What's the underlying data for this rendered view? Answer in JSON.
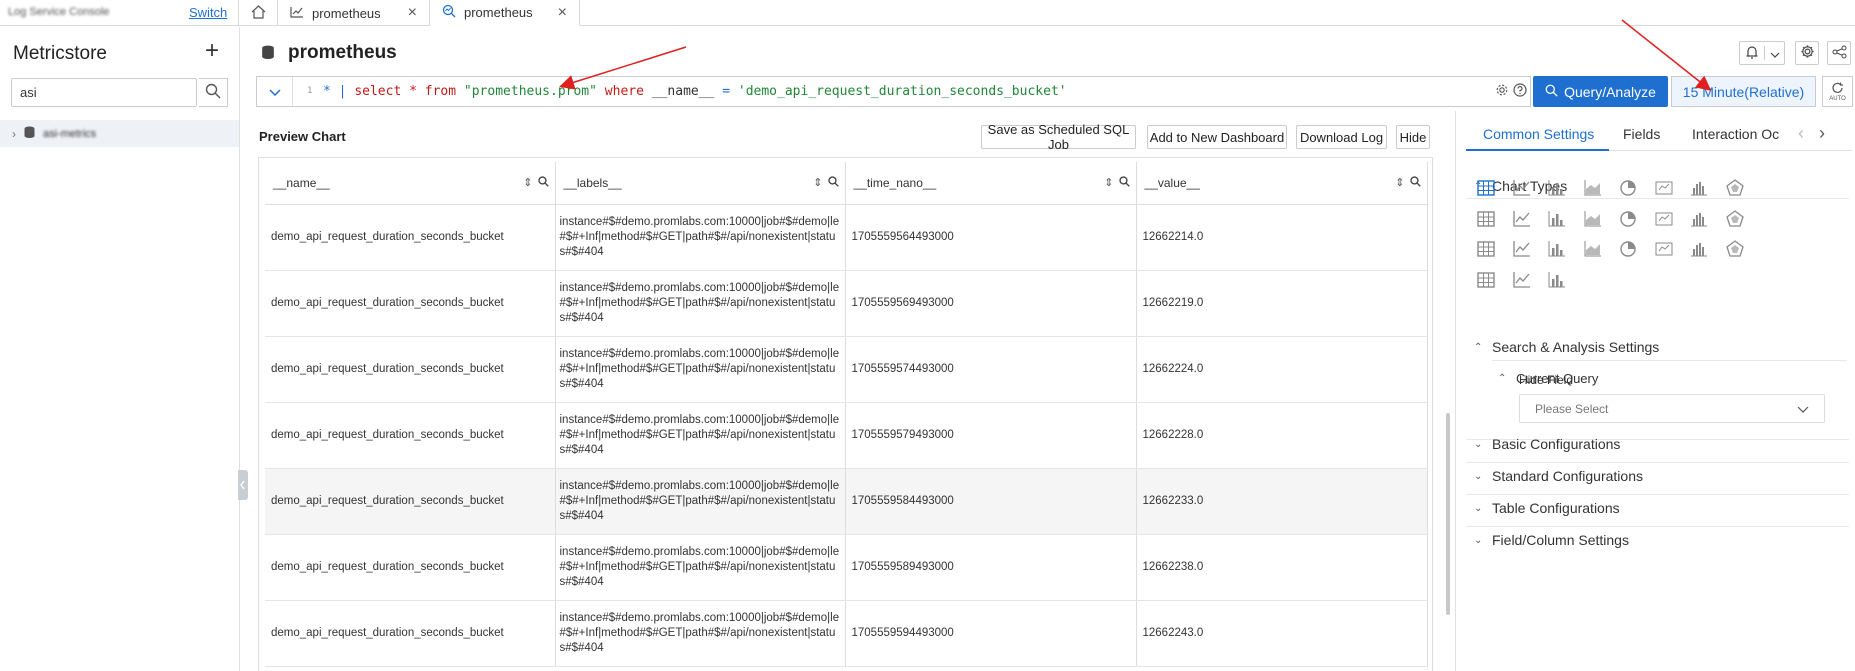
{
  "topbar": {
    "brand": "Log Service Console",
    "switch_label": "Switch",
    "tabs": [
      {
        "label": "prometheus",
        "icon": "line-chart-icon"
      },
      {
        "label": "prometheus",
        "icon": "query-icon"
      }
    ]
  },
  "sidebar": {
    "title": "Metricstore",
    "search_value": "asi",
    "tree_item": "asi-metrics"
  },
  "header": {
    "title": "prometheus"
  },
  "query": {
    "line_number": "1",
    "part_star": "*",
    "part_pipe": "|",
    "part_select": "select",
    "part_star2": "*",
    "part_from": "from",
    "part_table": "\"prometheus.prom\"",
    "part_where": "where",
    "part_field": "__name__",
    "part_eq": "=",
    "part_value": "'demo_api_request_duration_seconds_bucket'",
    "run_label": "Query/Analyze",
    "time_label": "15 Minute(Relative)",
    "auto_label": "AUTO"
  },
  "preview": {
    "title": "Preview Chart",
    "buttons": {
      "save_job": "Save as Scheduled SQL Job",
      "add_dashboard": "Add to New Dashboard",
      "download": "Download Log",
      "hide": "Hide"
    }
  },
  "table": {
    "columns": [
      "__name__",
      "__labels__",
      "__time_nano__",
      "__value__"
    ],
    "rows": [
      {
        "name": "demo_api_request_duration_seconds_bucket",
        "labels": "instance#$#demo.promlabs.com:10000|job#$#demo|le#$#+Inf|method#$#GET|path#$#/api/nonexistent|status#$#404",
        "time": "1705559564493000",
        "value": "12662214.0"
      },
      {
        "name": "demo_api_request_duration_seconds_bucket",
        "labels": "instance#$#demo.promlabs.com:10000|job#$#demo|le#$#+Inf|method#$#GET|path#$#/api/nonexistent|status#$#404",
        "time": "1705559569493000",
        "value": "12662219.0"
      },
      {
        "name": "demo_api_request_duration_seconds_bucket",
        "labels": "instance#$#demo.promlabs.com:10000|job#$#demo|le#$#+Inf|method#$#GET|path#$#/api/nonexistent|status#$#404",
        "time": "1705559574493000",
        "value": "12662224.0"
      },
      {
        "name": "demo_api_request_duration_seconds_bucket",
        "labels": "instance#$#demo.promlabs.com:10000|job#$#demo|le#$#+Inf|method#$#GET|path#$#/api/nonexistent|status#$#404",
        "time": "1705559579493000",
        "value": "12662228.0"
      },
      {
        "name": "demo_api_request_duration_seconds_bucket",
        "labels": "instance#$#demo.promlabs.com:10000|job#$#demo|le#$#+Inf|method#$#GET|path#$#/api/nonexistent|status#$#404",
        "time": "1705559584493000",
        "value": "12662233.0"
      },
      {
        "name": "demo_api_request_duration_seconds_bucket",
        "labels": "instance#$#demo.promlabs.com:10000|job#$#demo|le#$#+Inf|method#$#GET|path#$#/api/nonexistent|status#$#404",
        "time": "1705559589493000",
        "value": "12662238.0"
      },
      {
        "name": "demo_api_request_duration_seconds_bucket",
        "labels": "instance#$#demo.promlabs.com:10000|job#$#demo|le#$#+Inf|method#$#GET|path#$#/api/nonexistent|status#$#404",
        "time": "1705559594493000",
        "value": "12662243.0"
      }
    ]
  },
  "right_panel": {
    "tabs": [
      "Common Settings",
      "Fields",
      "Interaction Oc"
    ],
    "sections": {
      "chart_types": "Chart Types",
      "search_analysis": "Search & Analysis Settings",
      "current_query": "Current Query",
      "hide_field_label": "Hide Field",
      "hide_field_placeholder": "Please Select",
      "basic": "Basic Configurations",
      "standard": "Standard Configurations",
      "table_cfg": "Table Configurations",
      "field_column": "Field/Column Settings"
    },
    "chart_type_icons": [
      "table-pro-icon",
      "line-icon",
      "bar-icon",
      "area-icon",
      "pie-icon",
      "single-value-icon",
      "histogram-icon",
      "radar-icon",
      "table-icon",
      "scatter-icon",
      "china-map-icon",
      "world-map-icon",
      "map-icon",
      "map-bubble-icon",
      "progress-icon",
      "flow-icon",
      "sankey-icon",
      "word-cloud-icon",
      "treemap-icon",
      "funnel-icon",
      "column-icon",
      "bar-stacked-icon",
      "gauge-list-icon",
      "topology-icon",
      "map-pin-icon",
      "heatmap-icon",
      "candlestick-icon"
    ],
    "colors": {
      "accent": "#1f6fd1"
    }
  }
}
